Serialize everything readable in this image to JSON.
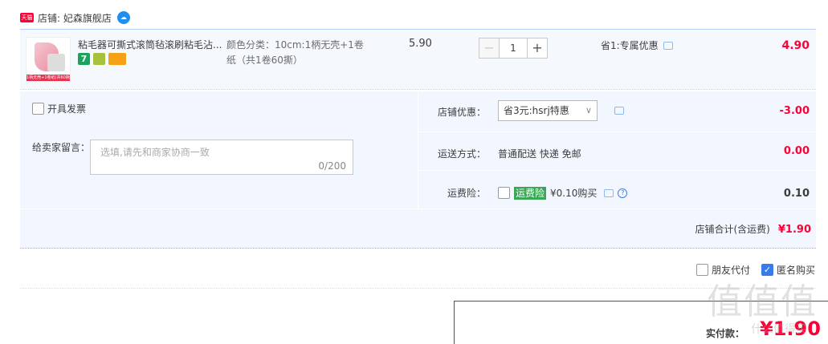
{
  "shop": {
    "badge": "天猫",
    "label": "店铺: 妃森旗舰店",
    "ww_icon": "aliwangwang-icon"
  },
  "item": {
    "thumb_strip": "1柄无壳+1卷纸(共60撕)",
    "title": "粘毛器可撕式滚筒毡滚刷粘毛沾...",
    "icons": [
      "seven-day-return-icon",
      "guarantee-icon",
      "card-icon"
    ],
    "seven_label": "7",
    "sku_line1": "颜色分类：10cm:1柄无壳+1卷",
    "sku_line2": "纸（共1卷60撕）",
    "unit_price": "5.90",
    "qty_minus": "−",
    "qty_value": "1",
    "qty_plus": "+",
    "promo": "省1:专属优惠",
    "total": "4.90"
  },
  "panel": {
    "invoice_label": "开具发票",
    "memo_label": "给卖家留言：",
    "memo_placeholder": "选填,请先和商家协商一致",
    "memo_count": "0/200",
    "shop_coupon_label": "店铺优惠：",
    "shop_coupon_selected": "省3元:hsrj特惠",
    "shop_coupon_value": "-3.00",
    "shipping_label": "运送方式：",
    "shipping_value": "普通配送 快递 免邮",
    "shipping_fee": "0.00",
    "insurance_label": "运费险：",
    "insurance_tag": "运费险",
    "insurance_price": "¥0.10购买",
    "insurance_value": "0.10",
    "sum_label": "店铺合计(含运费)",
    "sum_value": "¥1.90"
  },
  "options": {
    "friend_pay": "朋友代付",
    "anonymous": "匿名购买"
  },
  "pay": {
    "label": "实付款：",
    "amount": "¥1.90"
  },
  "watermark": {
    "text": "值值值",
    "sub": "什么值得买"
  },
  "colors": {
    "accent_red": "#ff0036",
    "panel_bg": "#f2f7ff",
    "check_blue": "#3a7bea"
  }
}
